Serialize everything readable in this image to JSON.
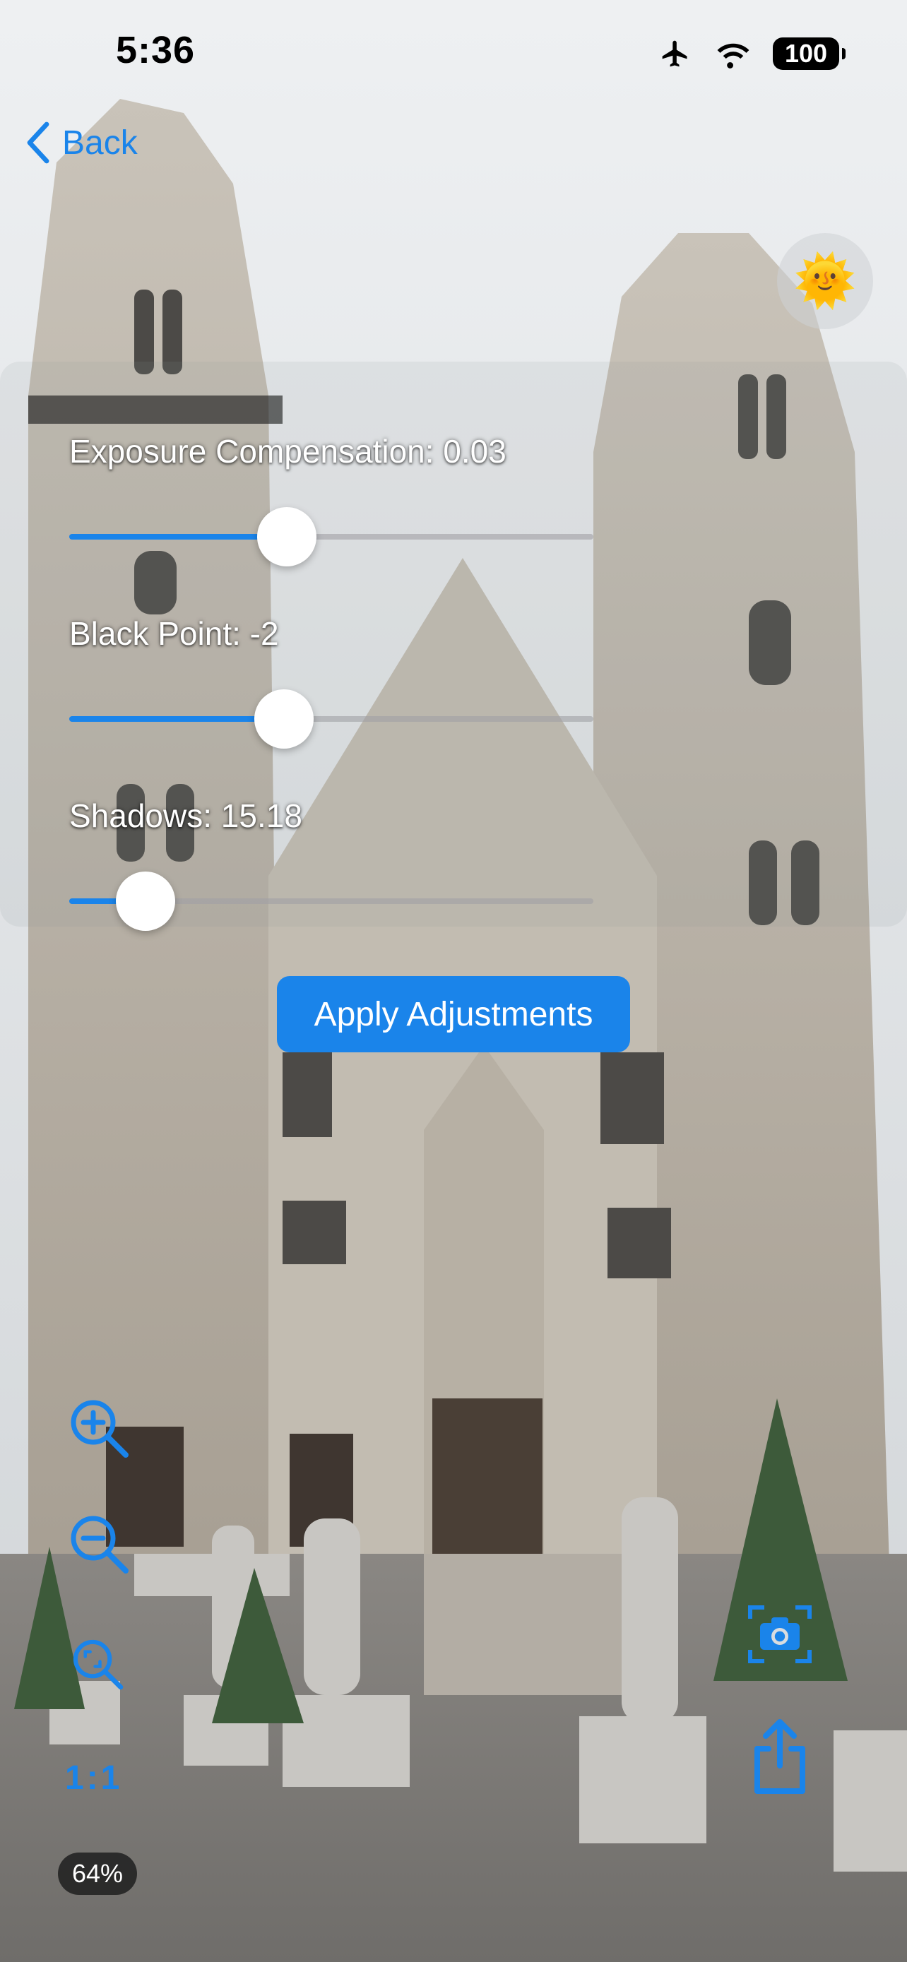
{
  "status_bar": {
    "time": "5:36",
    "battery": "100",
    "icons": [
      "airplane-icon",
      "wifi-icon",
      "battery-icon"
    ]
  },
  "nav": {
    "back_label": "Back"
  },
  "exposure_toggle": {
    "icon": "sun-face-icon",
    "glyph": "🌞"
  },
  "sliders": [
    {
      "label": "Exposure Compensation: 0.03",
      "fraction": 0.415
    },
    {
      "label": "Black Point: -2",
      "fraction": 0.41
    },
    {
      "label": "Shadows: 15.18",
      "fraction": 0.145
    }
  ],
  "apply_button": {
    "label": "Apply Adjustments"
  },
  "zoom_tools": {
    "zoom_in_icon": "zoom-in-icon",
    "zoom_out_icon": "zoom-out-icon",
    "zoom_fit_icon": "zoom-fit-icon",
    "ratio_label": "1:1",
    "zoom_level": "64%"
  },
  "actions": {
    "camera_icon": "camera-icon",
    "share_icon": "share-icon"
  },
  "colors": {
    "accent": "#1a84ea",
    "sky": "#e3e6e9",
    "stone": "#bdb6ac"
  }
}
